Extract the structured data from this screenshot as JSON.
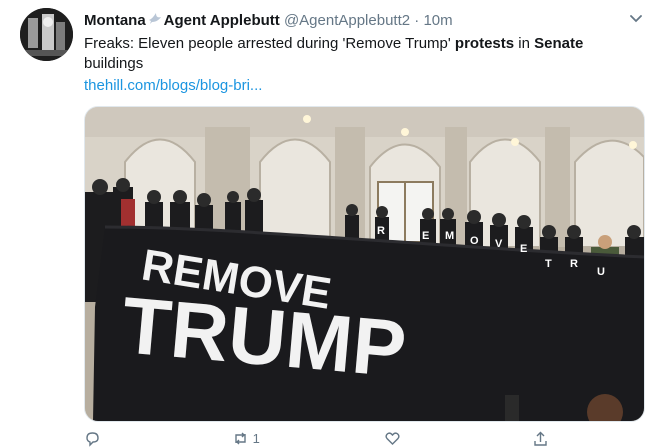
{
  "tweet": {
    "display_name": "Montana",
    "display_name_suffix": "Agent Applebutt",
    "handle": "@AgentApplebutt2",
    "separator": "·",
    "time": "10m",
    "text_parts": [
      "Freaks: Eleven people arrested during 'Remove Trump' ",
      "protests",
      " in ",
      "Senate",
      " buildings"
    ],
    "link_text": "thehill.com/blogs/blog-bri...",
    "banner_line1": "REMOVE",
    "banner_line2": "TRUMP",
    "shirt_letters": [
      "R",
      "E",
      "M",
      "O",
      "V",
      "E",
      "T",
      "R",
      "U"
    ],
    "retweet_count": "1",
    "icons": {
      "avatar": "avatar",
      "name_emoji": "dove-icon",
      "more": "chevron-down-icon",
      "reply": "reply-icon",
      "retweet": "retweet-icon",
      "like": "heart-icon",
      "share": "share-icon"
    }
  }
}
